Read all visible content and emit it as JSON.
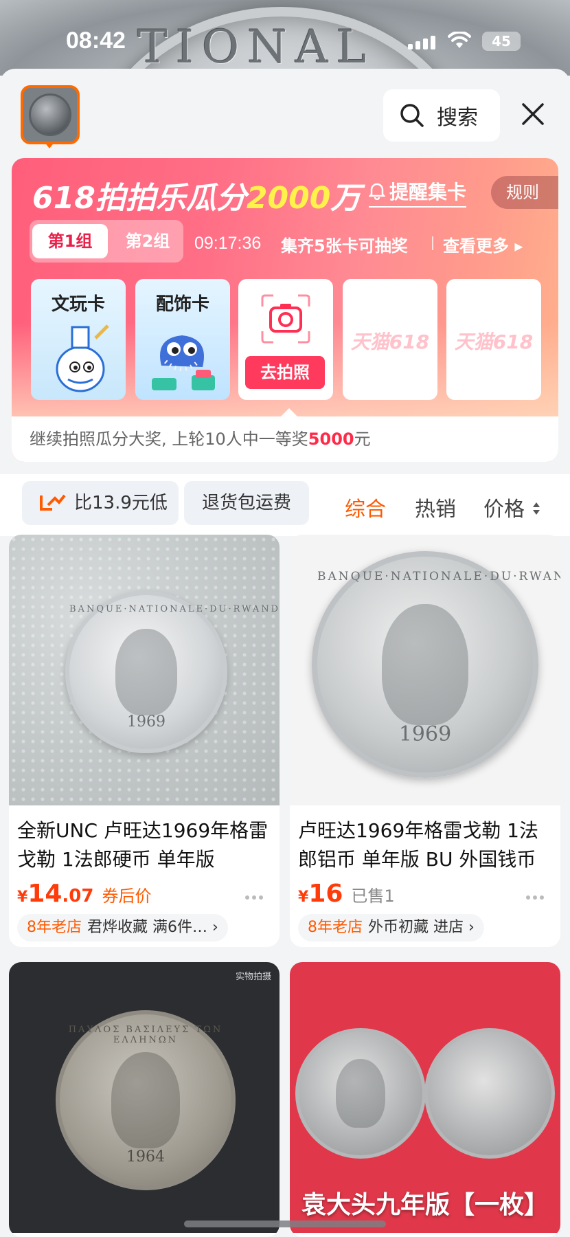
{
  "status_bar": {
    "time": "08:42",
    "battery": "45"
  },
  "header": {
    "search_label": "搜索"
  },
  "promo": {
    "title_prefix": "618",
    "title_middle": "拍拍乐瓜分",
    "title_amount": "2000",
    "title_suffix": "万",
    "remind_label": "提醒集卡",
    "rules_label": "规则",
    "group_tabs": [
      "第1组",
      "第2组"
    ],
    "timer": "09:17:36",
    "collect_text": "集齐5张卡可抽奖",
    "more_label": "查看更多",
    "cards": [
      "文玩卡",
      "配饰卡"
    ],
    "go_photo_label": "去拍照",
    "empty_card_watermark": "天猫618",
    "footer_text": "继续拍照瓜分大奖, 上轮10人中一等奖",
    "footer_amount": "5000",
    "footer_unit": "元"
  },
  "filters": {
    "chips": [
      "比13.9元低",
      "退货包运费"
    ],
    "sorts": [
      "综合",
      "热销",
      "价格"
    ],
    "active_sort": "综合"
  },
  "products": [
    {
      "title": "全新UNC 卢旺达1969年格雷戈勒 1法郎硬币 单年版",
      "price_int": "14",
      "price_dec": ".07",
      "note": "券后价",
      "shop_age": "8年老店",
      "shop_name": "君烨收藏 满6件…",
      "coin_text": "BANQUE·NATIONALE·DU·RWANDA",
      "coin_year": "1969"
    },
    {
      "title": "卢旺达1969年格雷戈勒 1法郎铝币 单年版 BU 外国钱币",
      "price_int": "16",
      "price_dec": "",
      "note": "已售1",
      "shop_age": "8年老店",
      "shop_name": "外币初藏 进店",
      "coin_text": "BANQUE·NATIONALE·DU·RWANDA",
      "coin_year": "1969"
    },
    {
      "image_tag": "实物拍摄",
      "coin_text": "ΠΑΥΛΟΣ ΒΑΣΙΛΕΥΣ ΤΩΝ ΕΛΛΗΝΩΝ",
      "coin_year": "1964"
    },
    {
      "caption": "袁大头九年版【一枚】"
    }
  ],
  "colors": {
    "accent": "#ff5a00",
    "promo_pink": "#ff5e7a",
    "price": "#ff3b0a"
  }
}
